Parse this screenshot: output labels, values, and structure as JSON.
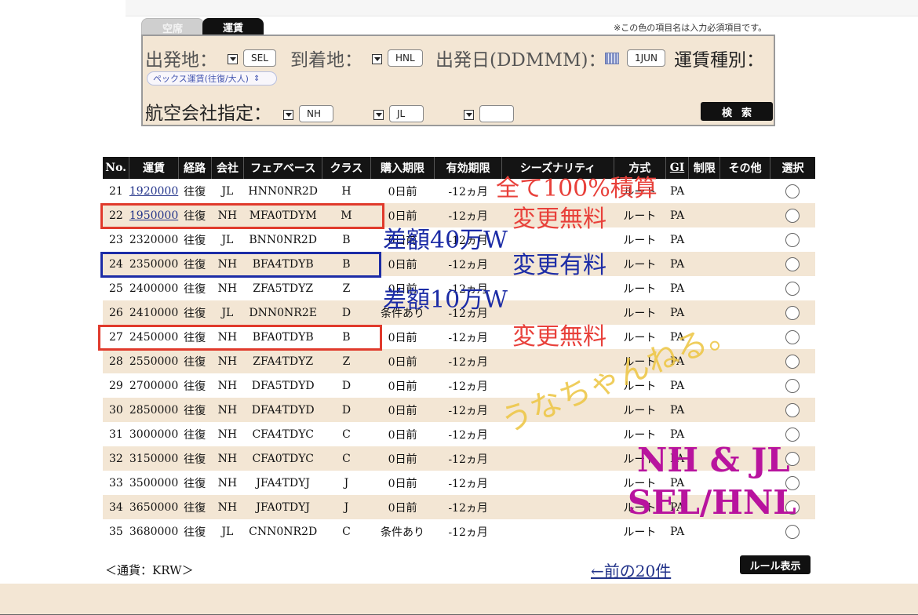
{
  "header": {
    "required_note": "※この色の項目名は入力必須項目です。",
    "tabs": [
      {
        "label": "空席"
      },
      {
        "label": "運賃"
      }
    ]
  },
  "search": {
    "origin_label": "出発地：",
    "origin_value": "SEL",
    "destination_label": "到着地：",
    "destination_value": "HNL",
    "date_label": "出発日(DDMMM)：",
    "date_value": "1JUN",
    "fare_type_label": "運賃種別：",
    "fare_type_value": "ペックス運賃(往復/大人)",
    "airline_label": "航空会社指定：",
    "airline_values": [
      "NH",
      "JL",
      ""
    ],
    "search_button": "検索"
  },
  "table": {
    "headers": [
      "No.",
      "運賃",
      "経路",
      "会社",
      "フェアベース",
      "クラス",
      "購入期限",
      "有効期限",
      "シーズナリティ",
      "方式",
      "GI",
      "制限",
      "その他",
      "選択"
    ],
    "rows": [
      {
        "no": "21",
        "fare": "1920000",
        "route": "往復",
        "airline": "JL",
        "fare_basis": "HNN0NR2D",
        "class": "H",
        "purchase": "0日前",
        "validity": "-12ヵ月",
        "season": "",
        "method": "ルート",
        "gi": "PA",
        "restriction": "",
        "other": ""
      },
      {
        "no": "22",
        "fare": "1950000",
        "route": "往復",
        "airline": "NH",
        "fare_basis": "MFA0TDYM",
        "class": "M",
        "purchase": "0日前",
        "validity": "-12ヵ月",
        "season": "",
        "method": "ルート",
        "gi": "PA",
        "restriction": "",
        "other": ""
      },
      {
        "no": "23",
        "fare": "2320000",
        "route": "往復",
        "airline": "JL",
        "fare_basis": "BNN0NR2D",
        "class": "B",
        "purchase": "0日前",
        "validity": "-12ヵ月",
        "season": "",
        "method": "ルート",
        "gi": "PA",
        "restriction": "",
        "other": ""
      },
      {
        "no": "24",
        "fare": "2350000",
        "route": "往復",
        "airline": "NH",
        "fare_basis": "BFA4TDYB",
        "class": "B",
        "purchase": "0日前",
        "validity": "-12ヵ月",
        "season": "",
        "method": "ルート",
        "gi": "PA",
        "restriction": "",
        "other": ""
      },
      {
        "no": "25",
        "fare": "2400000",
        "route": "往復",
        "airline": "NH",
        "fare_basis": "ZFA5TDYZ",
        "class": "Z",
        "purchase": "0日前",
        "validity": "-12ヵ月",
        "season": "",
        "method": "ルート",
        "gi": "PA",
        "restriction": "",
        "other": ""
      },
      {
        "no": "26",
        "fare": "2410000",
        "route": "往復",
        "airline": "JL",
        "fare_basis": "DNN0NR2E",
        "class": "D",
        "purchase": "条件あり",
        "validity": "-12ヵ月",
        "season": "",
        "method": "ルート",
        "gi": "PA",
        "restriction": "",
        "other": ""
      },
      {
        "no": "27",
        "fare": "2450000",
        "route": "往復",
        "airline": "NH",
        "fare_basis": "BFA0TDYB",
        "class": "B",
        "purchase": "0日前",
        "validity": "-12ヵ月",
        "season": "",
        "method": "ルート",
        "gi": "PA",
        "restriction": "",
        "other": ""
      },
      {
        "no": "28",
        "fare": "2550000",
        "route": "往復",
        "airline": "NH",
        "fare_basis": "ZFA4TDYZ",
        "class": "Z",
        "purchase": "0日前",
        "validity": "-12ヵ月",
        "season": "",
        "method": "ルート",
        "gi": "PA",
        "restriction": "",
        "other": ""
      },
      {
        "no": "29",
        "fare": "2700000",
        "route": "往復",
        "airline": "NH",
        "fare_basis": "DFA5TDYD",
        "class": "D",
        "purchase": "0日前",
        "validity": "-12ヵ月",
        "season": "",
        "method": "ルート",
        "gi": "PA",
        "restriction": "",
        "other": ""
      },
      {
        "no": "30",
        "fare": "2850000",
        "route": "往復",
        "airline": "NH",
        "fare_basis": "DFA4TDYD",
        "class": "D",
        "purchase": "0日前",
        "validity": "-12ヵ月",
        "season": "",
        "method": "ルート",
        "gi": "PA",
        "restriction": "",
        "other": ""
      },
      {
        "no": "31",
        "fare": "3000000",
        "route": "往復",
        "airline": "NH",
        "fare_basis": "CFA4TDYC",
        "class": "C",
        "purchase": "0日前",
        "validity": "-12ヵ月",
        "season": "",
        "method": "ルート",
        "gi": "PA",
        "restriction": "",
        "other": ""
      },
      {
        "no": "32",
        "fare": "3150000",
        "route": "往復",
        "airline": "NH",
        "fare_basis": "CFA0TDYC",
        "class": "C",
        "purchase": "0日前",
        "validity": "-12ヵ月",
        "season": "",
        "method": "ルート",
        "gi": "PA",
        "restriction": "",
        "other": ""
      },
      {
        "no": "33",
        "fare": "3500000",
        "route": "往復",
        "airline": "NH",
        "fare_basis": "JFA4TDYJ",
        "class": "J",
        "purchase": "0日前",
        "validity": "-12ヵ月",
        "season": "",
        "method": "ルート",
        "gi": "PA",
        "restriction": "",
        "other": ""
      },
      {
        "no": "34",
        "fare": "3650000",
        "route": "往復",
        "airline": "NH",
        "fare_basis": "JFA0TDYJ",
        "class": "J",
        "purchase": "0日前",
        "validity": "-12ヵ月",
        "season": "",
        "method": "ルート",
        "gi": "PA",
        "restriction": "",
        "other": ""
      },
      {
        "no": "35",
        "fare": "3680000",
        "route": "往復",
        "airline": "JL",
        "fare_basis": "CNN0NR2D",
        "class": "C",
        "purchase": "条件あり",
        "validity": "-12ヵ月",
        "season": "",
        "method": "ルート",
        "gi": "PA",
        "restriction": "",
        "other": ""
      }
    ]
  },
  "annotations": {
    "all_mileage": "全て100%積算",
    "change_free_1": "変更無料",
    "diff_400k": "差額40万W",
    "change_fee": "変更有料",
    "diff_100k": "差額10万W",
    "change_free_2": "変更無料",
    "watermark": "うなちゃんねる。",
    "airlines_note": "NH & JL",
    "route_note": "SEL/HNL"
  },
  "footer": {
    "currency": "＜通貨：KRW＞",
    "prev_link": "←前の20件",
    "rule_button": "ルール表示"
  },
  "colors": {
    "header_bg": "#141414",
    "alt_row_bg": "#f3e6d4",
    "link": "#22338a",
    "annotation_red": "#e8403a",
    "annotation_blue": "#1c2ca6",
    "annotation_magenta": "#b8139e"
  }
}
